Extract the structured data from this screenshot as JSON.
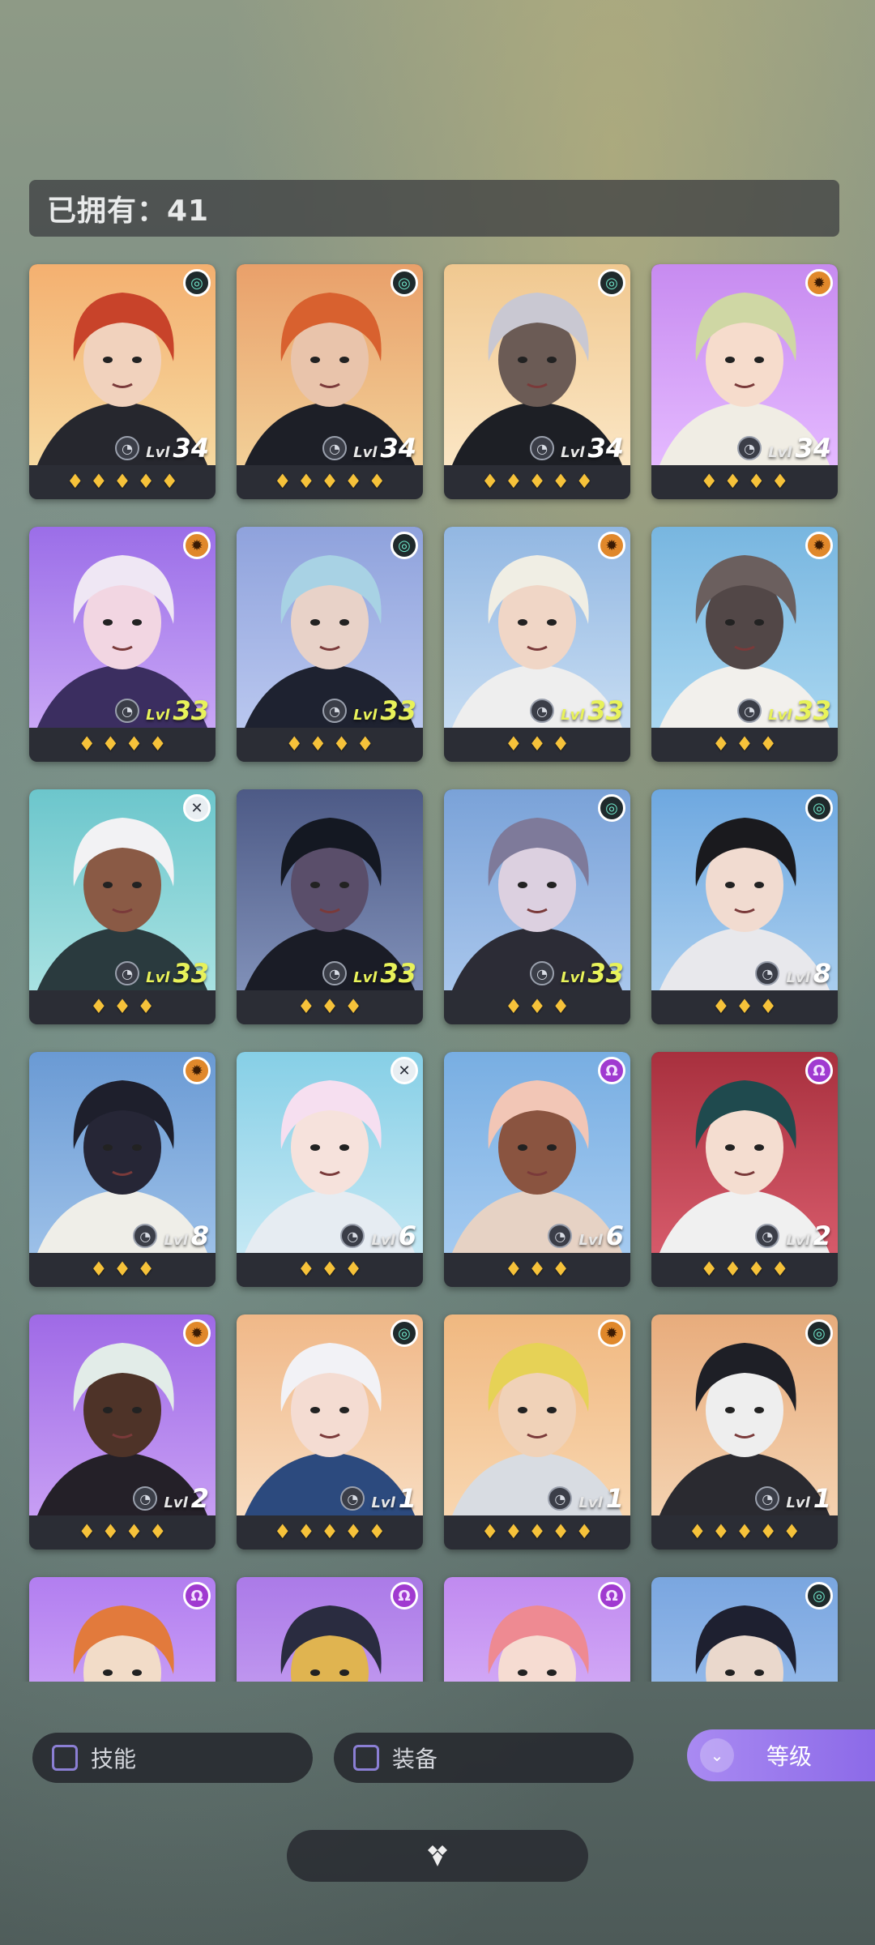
{
  "owned": {
    "label": "已拥有：41"
  },
  "heroes": [
    {
      "faction": "ring",
      "faction_glyph": "◎",
      "level": "34",
      "stars": "♦♦♦♦♦",
      "bg": [
        "#f4b070",
        "#f6d9a0"
      ],
      "hair": "#c8432a",
      "skin": "#f1d2bd",
      "cloth": "#26272e",
      "max": false
    },
    {
      "faction": "ring",
      "faction_glyph": "◎",
      "level": "34",
      "stars": "♦♦♦♦♦",
      "bg": [
        "#e9a06a",
        "#f2cf97"
      ],
      "hair": "#d8612f",
      "skin": "#e9c4ab",
      "cloth": "#1d1f27",
      "max": false
    },
    {
      "faction": "ring",
      "faction_glyph": "◎",
      "level": "34",
      "stars": "♦♦♦♦♦",
      "bg": [
        "#f0c890",
        "#fbe6c4"
      ],
      "hair": "#c9c8d2",
      "skin": "#6b5b55",
      "cloth": "#1d1f25",
      "max": false
    },
    {
      "faction": "sun",
      "faction_glyph": "✹",
      "level": "34",
      "stars": "♦♦♦♦",
      "bg": [
        "#c78bf0",
        "#e4b9ff"
      ],
      "hair": "#cfd7a4",
      "skin": "#f6dccc",
      "cloth": "#f0ede4",
      "max": false
    },
    {
      "faction": "sun",
      "faction_glyph": "✹",
      "level": "33",
      "stars": "♦♦♦♦",
      "bg": [
        "#9b6ee8",
        "#c9a6f6"
      ],
      "hair": "#efe7f4",
      "skin": "#f2d6e2",
      "cloth": "#3b2e60",
      "max": true
    },
    {
      "faction": "ring",
      "faction_glyph": "◎",
      "level": "33",
      "stars": "♦♦♦♦",
      "bg": [
        "#8fa2dc",
        "#b9c7ef"
      ],
      "hair": "#a8d2e4",
      "skin": "#e8d2c8",
      "cloth": "#1e2230",
      "max": true
    },
    {
      "faction": "sun",
      "faction_glyph": "✹",
      "level": "33",
      "stars": "♦♦♦",
      "bg": [
        "#92b7e2",
        "#c6dcf2"
      ],
      "hair": "#f0eee4",
      "skin": "#f0d6c6",
      "cloth": "#eeeeee",
      "max": true
    },
    {
      "faction": "sun",
      "faction_glyph": "✹",
      "level": "33",
      "stars": "♦♦♦",
      "bg": [
        "#78b6e0",
        "#a8d6f0"
      ],
      "hair": "#6b5f5e",
      "skin": "#524747",
      "cloth": "#f2f0ec",
      "max": true
    },
    {
      "faction": "x",
      "faction_glyph": "✕",
      "level": "33",
      "stars": "♦♦♦",
      "bg": [
        "#6cc6cc",
        "#a8e2e2"
      ],
      "hair": "#f2f2f4",
      "skin": "#8a5a45",
      "cloth": "#2a3a3e",
      "max": true
    },
    {
      "faction": "none",
      "faction_glyph": "",
      "level": "33",
      "stars": "♦♦♦",
      "bg": [
        "#4d5a86",
        "#8090b8"
      ],
      "hair": "#141822",
      "skin": "#5a4e6a",
      "cloth": "#1a1c26",
      "max": true
    },
    {
      "faction": "ring",
      "faction_glyph": "◎",
      "level": "33",
      "stars": "♦♦♦",
      "bg": [
        "#7aa2d8",
        "#a8c6ec"
      ],
      "hair": "#7e7a9a",
      "skin": "#dcd0e0",
      "cloth": "#2c2c36",
      "max": true
    },
    {
      "faction": "ring",
      "faction_glyph": "◎",
      "level": "8",
      "stars": "♦♦♦",
      "bg": [
        "#6ea8e0",
        "#a8cdee"
      ],
      "hair": "#1a1a1e",
      "skin": "#f1dbd0",
      "cloth": "#e8e8ec",
      "max": false
    },
    {
      "faction": "sun",
      "faction_glyph": "✹",
      "level": "8",
      "stars": "♦♦♦",
      "bg": [
        "#6a9ad4",
        "#9cc0e8"
      ],
      "hair": "#1e1f2c",
      "skin": "#262636",
      "cloth": "#efeee8",
      "max": false
    },
    {
      "faction": "x",
      "faction_glyph": "✕",
      "level": "6",
      "stars": "♦♦♦",
      "bg": [
        "#86cfe6",
        "#c4e8f4"
      ],
      "hair": "#f6dff0",
      "skin": "#f6e2dc",
      "cloth": "#e6ecf2",
      "max": false
    },
    {
      "faction": "omega",
      "faction_glyph": "Ω",
      "level": "6",
      "stars": "♦♦♦",
      "bg": [
        "#78aee2",
        "#a4caf0"
      ],
      "hair": "#f2c6b6",
      "skin": "#8a5440",
      "cloth": "#e6d2c4",
      "max": false
    },
    {
      "faction": "omega",
      "faction_glyph": "Ω",
      "level": "2",
      "stars": "♦♦♦♦",
      "bg": [
        "#a8303e",
        "#d65a6a"
      ],
      "hair": "#1f4a4e",
      "skin": "#f4ddd0",
      "cloth": "#f0f0f0",
      "max": false
    },
    {
      "faction": "sun",
      "faction_glyph": "✹",
      "level": "2",
      "stars": "♦♦♦♦",
      "bg": [
        "#9f6ae6",
        "#c79ef4"
      ],
      "hair": "#e2ece8",
      "skin": "#4e3328",
      "cloth": "#242028",
      "max": false
    },
    {
      "faction": "ring",
      "faction_glyph": "◎",
      "level": "1",
      "stars": "♦♦♦♦♦",
      "bg": [
        "#f0b888",
        "#f8dcc0"
      ],
      "hair": "#f2f2f6",
      "skin": "#f4dcd2",
      "cloth": "#2c4a7e",
      "max": false
    },
    {
      "faction": "sun",
      "faction_glyph": "✹",
      "level": "1",
      "stars": "♦♦♦♦♦",
      "bg": [
        "#f0b880",
        "#f8d6b0"
      ],
      "hair": "#e6d256",
      "skin": "#f0d2b8",
      "cloth": "#d8dce2",
      "max": false
    },
    {
      "faction": "ring",
      "faction_glyph": "◎",
      "level": "1",
      "stars": "♦♦♦♦♦",
      "bg": [
        "#e8ac7c",
        "#f4d2b0"
      ],
      "hair": "#1e1f26",
      "skin": "#eeeeee",
      "cloth": "#2a2a30",
      "max": false
    },
    {
      "faction": "omega",
      "faction_glyph": "Ω",
      "level": "",
      "stars": "",
      "bg": [
        "#b27ef0",
        "#d8b4fa"
      ],
      "hair": "#e27a3c",
      "skin": "#f2dcc8",
      "cloth": "#f0f0f0",
      "max": false
    },
    {
      "faction": "omega",
      "faction_glyph": "Ω",
      "level": "",
      "stars": "",
      "bg": [
        "#ab7ae8",
        "#d0aef4"
      ],
      "hair": "#2a2c40",
      "skin": "#e0b450",
      "cloth": "#3a3a60",
      "max": false
    },
    {
      "faction": "omega",
      "faction_glyph": "Ω",
      "level": "",
      "stars": "",
      "bg": [
        "#c08af0",
        "#e0c0fa"
      ],
      "hair": "#ee8a92",
      "skin": "#f6dcd2",
      "cloth": "#f0f0f0",
      "max": false
    },
    {
      "faction": "ring",
      "faction_glyph": "◎",
      "level": "",
      "stars": "",
      "bg": [
        "#7aa6e0",
        "#a8c8f0"
      ],
      "hair": "#1e2030",
      "skin": "#ead8cc",
      "cloth": "#2a2c3a",
      "max": false
    }
  ],
  "labels": {
    "lvl": "Lvl"
  },
  "filters": {
    "skill": "技能",
    "equip": "装备"
  },
  "sort": {
    "label": "等级",
    "icon": "chevron-double-down-icon"
  },
  "bottom": {
    "icon": "diamond-cluster-icon"
  },
  "colors": {
    "accent": "#8c6ae8",
    "max_level": "#e8f25a",
    "star": "#f6c23a"
  }
}
